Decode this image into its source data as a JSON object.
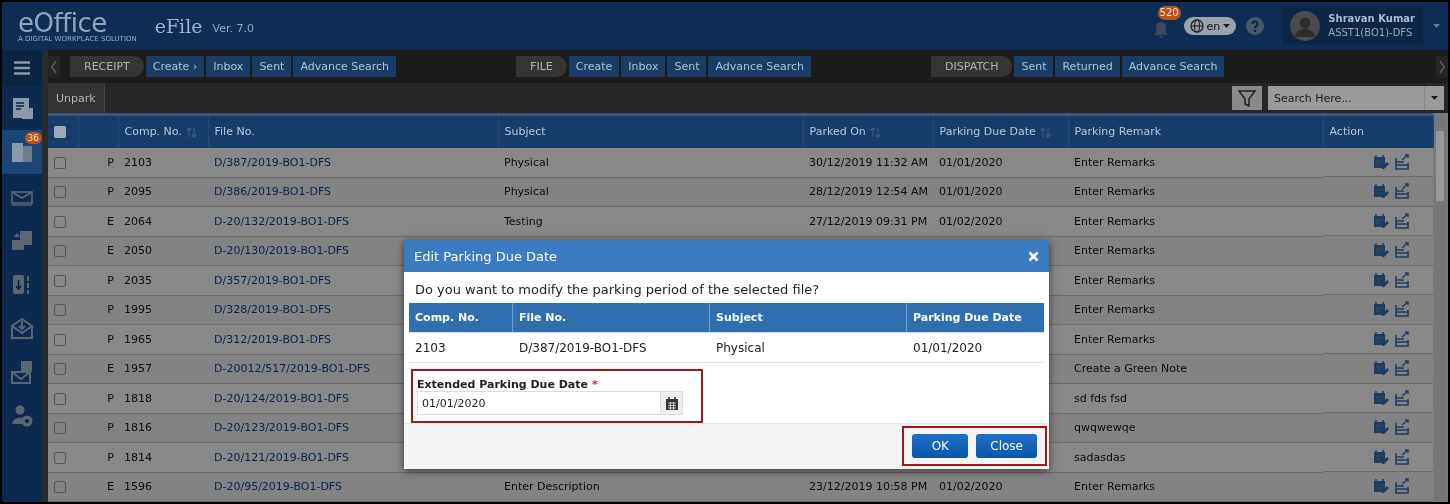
{
  "header": {
    "logo": "eOffice",
    "tagline": "A DIGITAL WORKPLACE SOLUTION",
    "app_name": "eFile",
    "version": "Ver. 7.0",
    "notification_count": "520",
    "language": "en",
    "user_name": "Shravan Kumar",
    "user_role": "ASST1(BO1)-DFS"
  },
  "nav": [
    {
      "title": "RECEIPT",
      "items": [
        "Create ›",
        "Inbox",
        "Sent",
        "Advance Search"
      ]
    },
    {
      "title": "FILE",
      "items": [
        "Create",
        "Inbox",
        "Sent",
        "Advance Search"
      ]
    },
    {
      "title": "DISPATCH",
      "items": [
        "Sent",
        "Returned",
        "Advance Search"
      ]
    }
  ],
  "sidebar": {
    "items": [
      {
        "kind": "receipt",
        "selected": false
      },
      {
        "kind": "file",
        "badge": "36",
        "selected": true
      },
      {
        "kind": "dispatch",
        "selected": false
      },
      {
        "kind": "migrate",
        "selected": false
      },
      {
        "kind": "dsc",
        "selected": false
      },
      {
        "kind": "inbox",
        "selected": false
      },
      {
        "kind": "notice",
        "selected": false
      },
      {
        "kind": "admin",
        "selected": false
      }
    ]
  },
  "toolbar": {
    "unpark": "Unpark",
    "search": {
      "placeholder": "Search Here..."
    }
  },
  "table": {
    "select_all_checked": false,
    "columns": [
      {
        "kind": "check"
      },
      {
        "kind": "type"
      },
      {
        "label": "Comp. No.",
        "sortable": true
      },
      {
        "label": "File No."
      },
      {
        "label": "Subject"
      },
      {
        "label": "Parked On",
        "sortable": true
      },
      {
        "label": "Parking Due Date",
        "sortable": true
      },
      {
        "label": "Parking Remark"
      },
      {
        "label": "Action"
      }
    ],
    "rows": [
      {
        "checked": false,
        "type": "P",
        "comp_no": "2103",
        "file_no": "D/387/2019-BO1-DFS",
        "subject": "Physical",
        "parked_on": "30/12/2019 11:32 AM",
        "due_date": "01/01/2020",
        "remark": "Enter Remarks"
      },
      {
        "checked": false,
        "type": "P",
        "comp_no": "2095",
        "file_no": "D/386/2019-BO1-DFS",
        "subject": "Physical",
        "parked_on": "28/12/2019 12:54 AM",
        "due_date": "01/01/2020",
        "remark": "Enter Remarks"
      },
      {
        "checked": false,
        "type": "E",
        "comp_no": "2064",
        "file_no": "D-20/132/2019-BO1-DFS",
        "subject": "Testing",
        "parked_on": "27/12/2019 09:31 PM",
        "due_date": "01/02/2020",
        "remark": "Enter Remarks"
      },
      {
        "checked": false,
        "type": "E",
        "comp_no": "2050",
        "file_no": "D-20/130/2019-BO1-DFS",
        "remark": "Enter Remarks"
      },
      {
        "checked": false,
        "type": "P",
        "comp_no": "2035",
        "file_no": "D/357/2019-BO1-DFS",
        "remark": "Enter Remarks"
      },
      {
        "checked": false,
        "type": "P",
        "comp_no": "1995",
        "file_no": "D/328/2019-BO1-DFS",
        "remark": "Enter Remarks"
      },
      {
        "checked": false,
        "type": "P",
        "comp_no": "1965",
        "file_no": "D/312/2019-BO1-DFS",
        "remark": "Enter Remarks"
      },
      {
        "checked": false,
        "type": "E",
        "comp_no": "1957",
        "file_no": "D-20012/517/2019-BO1-DFS",
        "remark": "Create a Green Note"
      },
      {
        "checked": false,
        "type": "P",
        "comp_no": "1818",
        "file_no": "D-20/124/2019-BO1-DFS",
        "remark": "sd fds fsd"
      },
      {
        "checked": false,
        "type": "P",
        "comp_no": "1816",
        "file_no": "D-20/123/2019-BO1-DFS",
        "remark": "qwqwewqe"
      },
      {
        "checked": false,
        "type": "P",
        "comp_no": "1814",
        "file_no": "D-20/121/2019-BO1-DFS",
        "remark": "sadasdas"
      },
      {
        "checked": false,
        "type": "E",
        "comp_no": "1596",
        "file_no": "D-20/95/2019-BO1-DFS",
        "subject": "Enter Description",
        "parked_on": "23/12/2019 10:58 PM",
        "due_date": "01/02/2020",
        "remark": "Enter Remarks"
      }
    ]
  },
  "dialog": {
    "title": "Edit Parking Due Date",
    "question": "Do you want to modify the parking period of the selected file?",
    "columns": [
      "Comp. No.",
      "File No.",
      "Subject",
      "Parking Due Date"
    ],
    "row": [
      "2103",
      "D/387/2019-BO1-DFS",
      "Physical",
      "01/01/2020"
    ],
    "field": {
      "label": "Extended Parking Due Date",
      "required": true,
      "required_mark": "*",
      "value": "01/01/2020"
    },
    "buttons": [
      "OK",
      "Close"
    ]
  }
}
